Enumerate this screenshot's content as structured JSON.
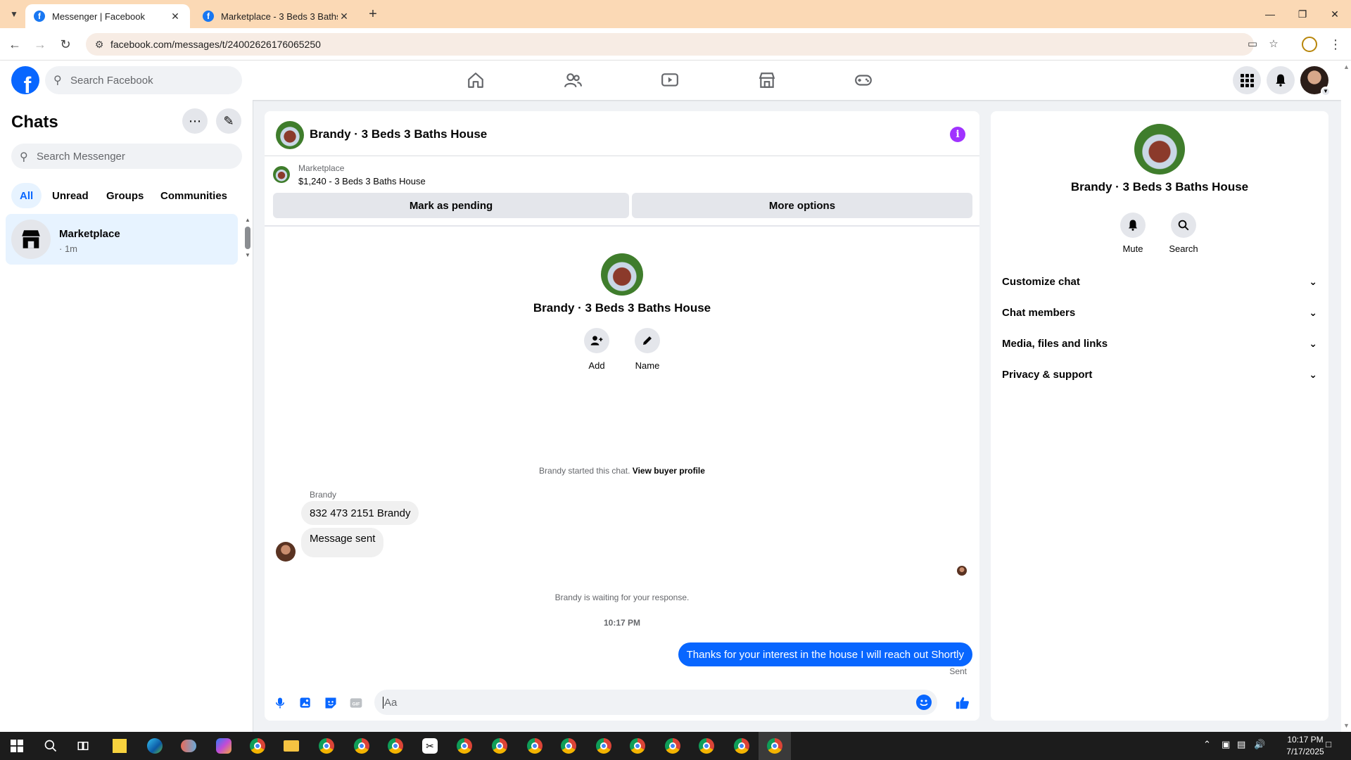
{
  "browser": {
    "tabs": [
      {
        "title": "Messenger | Facebook",
        "active": true
      },
      {
        "title": "Marketplace - 3 Beds 3 Baths H",
        "active": false
      }
    ],
    "url": "facebook.com/messages/t/24002626176065250"
  },
  "facebook": {
    "search_placeholder": "Search Facebook"
  },
  "chats": {
    "title": "Chats",
    "search_placeholder": "Search Messenger",
    "filters": [
      "All",
      "Unread",
      "Groups",
      "Communities"
    ],
    "active_filter": "All",
    "conversations": [
      {
        "name": "Marketplace",
        "time": "· 1m"
      }
    ]
  },
  "conversation": {
    "name": "Brandy · 3 Beds 3 Baths House",
    "marketplace_label": "Marketplace",
    "listing": "$1,240 - 3 Beds 3 Baths House",
    "mark_pending": "Mark as pending",
    "more_options": "More options",
    "intro_actions": [
      {
        "label": "Add",
        "icon": "add-person-icon"
      },
      {
        "label": "Name",
        "icon": "pencil-icon"
      }
    ],
    "started_text": "Brandy started this chat.",
    "view_profile": "View buyer profile",
    "sender": "Brandy",
    "incoming": [
      "832 473 2151 Brandy",
      "Message sent"
    ],
    "waiting": "Brandy is waiting for your response.",
    "timestamp": "10:17 PM",
    "outgoing": "Thanks for your interest in the house I will reach out Shortly",
    "status": "Sent",
    "composer_placeholder": "Aa"
  },
  "details": {
    "name": "Brandy · 3 Beds 3 Baths House",
    "actions": [
      {
        "label": "Mute",
        "icon": "bell-icon"
      },
      {
        "label": "Search",
        "icon": "search-icon"
      }
    ],
    "sections": [
      "Customize chat",
      "Chat members",
      "Media, files and links",
      "Privacy & support"
    ]
  },
  "taskbar": {
    "time": "10:17 PM",
    "date": "7/17/2025"
  },
  "colors": {
    "brand": "#0866ff",
    "tab_bar": "#fbd9b5",
    "info": "#a033ff"
  }
}
